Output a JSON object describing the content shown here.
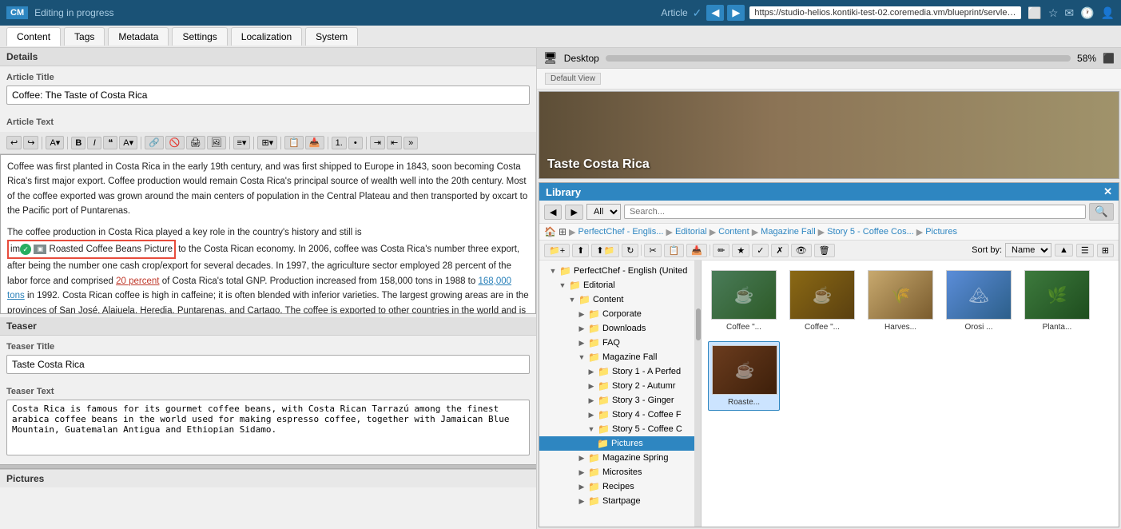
{
  "topbar": {
    "logo": "CM",
    "status": "Editing in progress",
    "article_label": "Article",
    "url": "https://studio-helios.kontiki-test-02.coremedia.vm/blueprint/servlet/perfectchef/mag",
    "nav_back": "◀",
    "nav_forward": "▶"
  },
  "tabs": {
    "items": [
      "Content",
      "Tags",
      "Metadata",
      "Settings",
      "Localization",
      "System"
    ],
    "active": "Content"
  },
  "details_header": "Details",
  "article_title_label": "Article Title",
  "article_title_value": "Coffee: The Taste of Costa Rica",
  "article_text_label": "Article Text",
  "article_text_para1": "Coffee was first planted in Costa Rica in the early 19th century, and was first shipped to Europe in 1843, soon becoming Costa Rica's first major export. Coffee production would remain Costa Rica's principal source of wealth well into the 20th century. Most of the coffee exported was grown around the main centers of population in the Central Plateau and then transported by oxcart to the Pacific port of Puntarenas.",
  "article_text_para2": "The coffee production in Costa Rica played a key role in the country's history and still is important to the Costa Rican economy. In 2006, coffee was Costa Rica's number three export, after being the number one cash crop/export for several decades. In 1997, the agriculture sector employed 28 percent of the labor force and comprised 20 percent of Costa Rica's total GNP. Production increased from 158,000 tons in 1988 to 168,000 tons in 1992. Costa Rican coffee is high in caffeine; it is often blended with inferior varieties. The largest growing areas are in the provinces of San José, Alajuela, Heredia, Puntarenas, and Cartago. The coffee is exported to other countries in the world and is also exported to cities in Costa Rica.",
  "popup_text": "Roasted Coffee Beans Picture",
  "teaser_header": "Teaser",
  "teaser_title_label": "Teaser Title",
  "teaser_title_value": "Taste Costa Rica",
  "teaser_text_label": "Teaser Text",
  "teaser_text_value": "Costa Rica is famous for its gourmet coffee beans, with Costa Rican Tarrazú among the finest arabica coffee beans in the world used for making espresso coffee, together with Jamaican Blue Mountain, Guatemalan Antigua and Ethiopian Sidamo.",
  "pictures_label": "Pictures",
  "desktop_label": "Desktop",
  "desktop_zoom": "58%",
  "preview_title": "Taste Costa Rica",
  "default_view": "Default View",
  "library": {
    "title": "Library",
    "close": "✕",
    "search_placeholder": "Search...",
    "dropdown_value": "All",
    "sort_label": "Sort by:",
    "sort_value": "Name",
    "breadcrumb": [
      "PerfectChef - Englis...",
      "Editorial",
      "Content",
      "Magazine Fall",
      "Story 5 - Coffee Cos...",
      "Pictures"
    ],
    "tree": [
      {
        "label": "PerfectChef - English (United",
        "level": 0,
        "expanded": true,
        "type": "root"
      },
      {
        "label": "Editorial",
        "level": 1,
        "expanded": true,
        "type": "folder"
      },
      {
        "label": "Content",
        "level": 2,
        "expanded": true,
        "type": "folder"
      },
      {
        "label": "Corporate",
        "level": 3,
        "expanded": false,
        "type": "folder"
      },
      {
        "label": "Downloads",
        "level": 3,
        "expanded": false,
        "type": "folder"
      },
      {
        "label": "FAQ",
        "level": 3,
        "expanded": false,
        "type": "folder"
      },
      {
        "label": "Magazine Fall",
        "level": 3,
        "expanded": true,
        "type": "folder"
      },
      {
        "label": "Story 1 - A Perfed",
        "level": 4,
        "expanded": false,
        "type": "folder"
      },
      {
        "label": "Story 2 - Autumr",
        "level": 4,
        "expanded": false,
        "type": "folder"
      },
      {
        "label": "Story 3 - Ginger",
        "level": 4,
        "expanded": false,
        "type": "folder"
      },
      {
        "label": "Story 4 - Coffee F",
        "level": 4,
        "expanded": false,
        "type": "folder"
      },
      {
        "label": "Story 5 - Coffee C",
        "level": 4,
        "expanded": true,
        "type": "folder"
      },
      {
        "label": "Pictures",
        "level": 5,
        "expanded": false,
        "type": "folder",
        "selected": true
      },
      {
        "label": "Magazine Spring",
        "level": 3,
        "expanded": false,
        "type": "folder"
      },
      {
        "label": "Microsites",
        "level": 3,
        "expanded": false,
        "type": "folder"
      },
      {
        "label": "Recipes",
        "level": 3,
        "expanded": false,
        "type": "folder"
      },
      {
        "label": "Startpage",
        "level": 3,
        "expanded": false,
        "type": "folder"
      }
    ],
    "grid_items": [
      {
        "label": "Coffee...",
        "type": "coffee1"
      },
      {
        "label": "Coffee...",
        "type": "coffee2"
      },
      {
        "label": "Harves...",
        "type": "harvest"
      },
      {
        "label": "Orosi ...",
        "type": "orosi"
      },
      {
        "label": "Planta...",
        "type": "planta"
      },
      {
        "label": "Roaste...",
        "type": "roasted",
        "selected": true
      }
    ]
  }
}
